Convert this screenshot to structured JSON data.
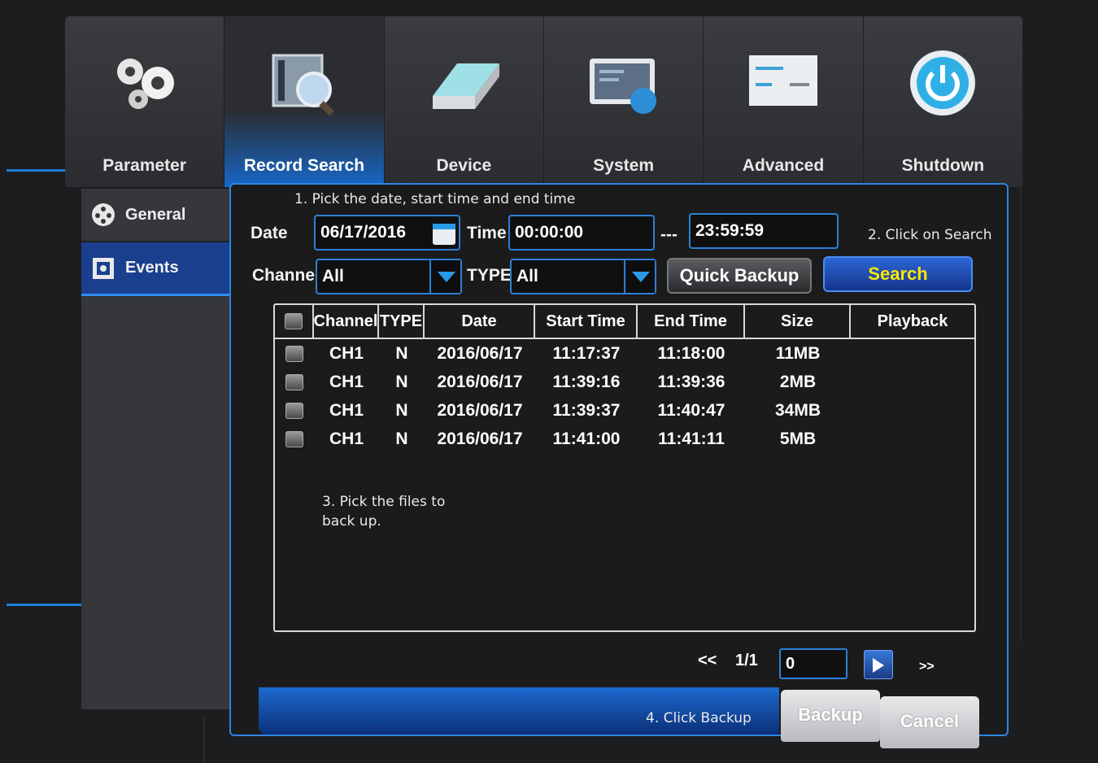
{
  "tabs": [
    {
      "label": "Parameter",
      "icon": "gears-icon",
      "active": false
    },
    {
      "label": "Record Search",
      "icon": "record-search-icon",
      "active": true
    },
    {
      "label": "Device",
      "icon": "hard-drive-icon",
      "active": false
    },
    {
      "label": "System",
      "icon": "system-info-icon",
      "active": false
    },
    {
      "label": "Advanced",
      "icon": "advanced-settings-icon",
      "active": false
    },
    {
      "label": "Shutdown",
      "icon": "power-icon",
      "active": false
    }
  ],
  "sidebar": {
    "items": [
      {
        "label": "General",
        "icon": "film-reel-icon",
        "active": false
      },
      {
        "label": "Events",
        "icon": "film-strip-icon",
        "active": true
      }
    ]
  },
  "annotations": {
    "step1": "1. Pick the date, start time and end time",
    "step2": "2. Click on Search",
    "step3_line1": "3. Pick the files to",
    "step3_line2": "back up.",
    "step4": "4. Click Backup"
  },
  "filters": {
    "date_label": "Date",
    "date_value": "06/17/2016",
    "time_label": "Time",
    "start_time": "00:00:00",
    "separator": "---",
    "end_time": "23:59:59",
    "channel_label": "Channel",
    "channel_value": "All",
    "type_label": "TYPE",
    "type_value": "All",
    "quick_backup_label": "Quick Backup",
    "search_label": "Search"
  },
  "table": {
    "columns": [
      "Channel",
      "TYPE",
      "Date",
      "Start Time",
      "End Time",
      "Size",
      "Playback"
    ],
    "rows": [
      {
        "channel": "CH1",
        "type": "N",
        "date": "2016/06/17",
        "start": "11:17:37",
        "end": "11:18:00",
        "size": "11MB"
      },
      {
        "channel": "CH1",
        "type": "N",
        "date": "2016/06/17",
        "start": "11:39:16",
        "end": "11:39:36",
        "size": "2MB"
      },
      {
        "channel": "CH1",
        "type": "N",
        "date": "2016/06/17",
        "start": "11:39:37",
        "end": "11:40:47",
        "size": "34MB"
      },
      {
        "channel": "CH1",
        "type": "N",
        "date": "2016/06/17",
        "start": "11:41:00",
        "end": "11:41:11",
        "size": "5MB"
      }
    ]
  },
  "pager": {
    "prev": "<<",
    "page": "1/1",
    "input_value": "0",
    "next": ">>"
  },
  "footer": {
    "backup_label": "Backup",
    "cancel_label": "Cancel"
  },
  "colors": {
    "accent_blue": "#2b86e0",
    "search_text": "#ffe600"
  }
}
